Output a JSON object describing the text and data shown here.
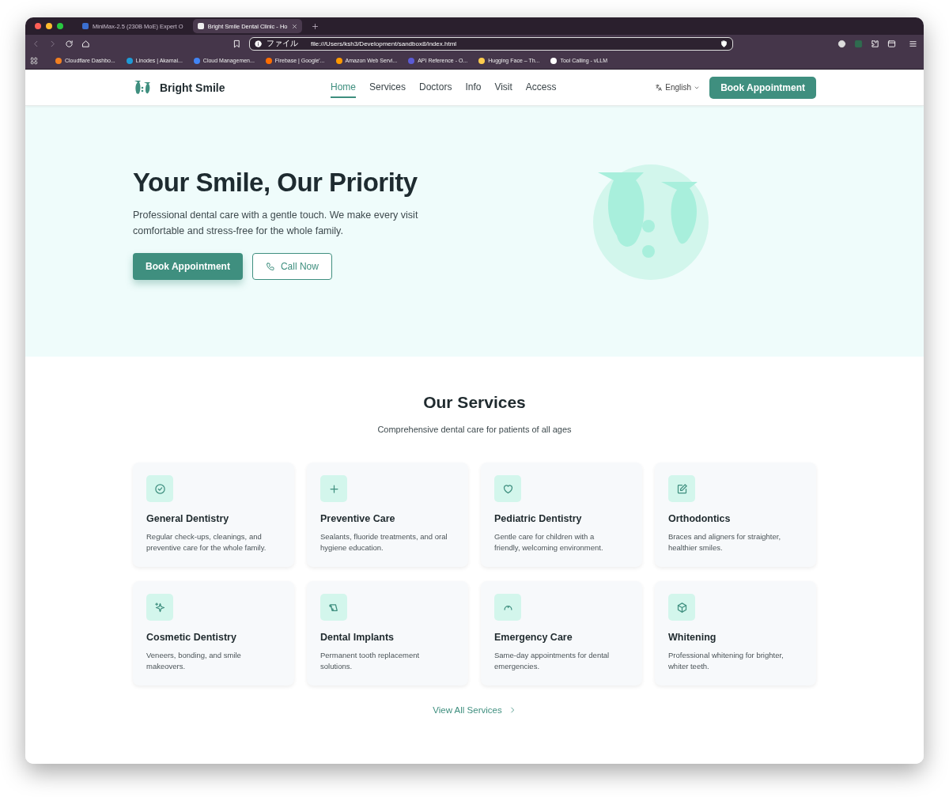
{
  "browser": {
    "tabs": [
      {
        "title": "MiniMax-2.5 (230B MoE) Expert O",
        "selected": false
      },
      {
        "title": "Bright Smile Dental Clinic - Ho",
        "selected": true
      }
    ],
    "address": {
      "scheme": "ファイル",
      "url": "file:///Users/ksh3/Development/sandbox8/index.html"
    },
    "bookmarks": [
      "Cloudflare Dashbo...",
      "Linodes | Akamai...",
      "Cloud Managemen...",
      "Firebase | Google'...",
      "Amazon Web Servi...",
      "API Reference - O...",
      "Hugging Face – Th...",
      "Tool Calling - vLLM"
    ]
  },
  "nav": {
    "brand": "Bright Smile",
    "links": [
      {
        "label": "Home",
        "selected": true
      },
      {
        "label": "Services",
        "selected": false
      },
      {
        "label": "Doctors",
        "selected": false
      },
      {
        "label": "Info",
        "selected": false
      },
      {
        "label": "Visit",
        "selected": false
      },
      {
        "label": "Access",
        "selected": false
      }
    ],
    "language": "English",
    "cta": "Book Appointment"
  },
  "hero": {
    "title": "Your Smile, Our Priority",
    "text": "Professional dental care with a gentle touch. We make every visit comfortable and stress-free for the whole family.",
    "buttons": [
      {
        "label": "Book Appointment",
        "kind": "primary"
      },
      {
        "label": "Call Now",
        "kind": "phone"
      }
    ]
  },
  "services": {
    "title": "Our Services",
    "subtitle": "Comprehensive dental care for patients of all ages",
    "cards": [
      {
        "kind": "check",
        "title": "General Dentistry",
        "text": "Regular check-ups, cleanings, and preventive care for the whole family."
      },
      {
        "kind": "plus",
        "title": "Preventive Care",
        "text": "Sealants, fluoride treatments, and oral hygiene education."
      },
      {
        "kind": "heart",
        "title": "Pediatric Dentistry",
        "text": "Gentle care for children with a friendly, welcoming environment."
      },
      {
        "kind": "pencil",
        "title": "Orthodontics",
        "text": "Braces and aligners for straighter, healthier smiles."
      },
      {
        "kind": "sparkle",
        "title": "Cosmetic Dentistry",
        "text": "Veneers, bonding, and smile makeovers."
      },
      {
        "kind": "scroll",
        "title": "Dental Implants",
        "text": "Permanent tooth replacement solutions."
      },
      {
        "kind": "gauge",
        "title": "Emergency Care",
        "text": "Same-day appointments for dental emergencies."
      },
      {
        "kind": "box",
        "title": "Whitening",
        "text": "Professional whitening for brighter, whiter teeth."
      }
    ],
    "link": "View All Services"
  }
}
